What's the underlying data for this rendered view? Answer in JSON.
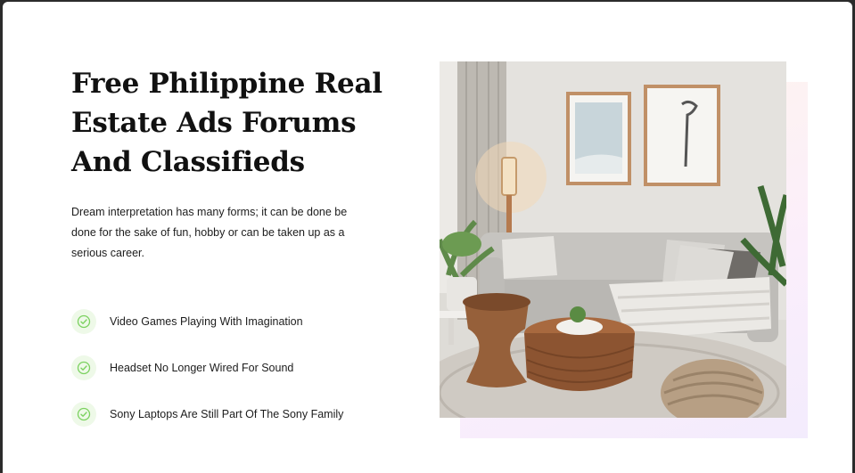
{
  "hero": {
    "title": "Free Philippine Real Estate Ads Forums And Classifieds",
    "description": "Dream interpretation has many forms; it can be done be done for the sake of fun, hobby or can be taken up as a serious career.",
    "features": [
      {
        "label": "Video Games Playing With Imagination",
        "icon": "check-circle-icon"
      },
      {
        "label": "Headset No Longer Wired For Sound",
        "icon": "check-circle-icon"
      },
      {
        "label": "Sony Laptops Are Still Part Of The Sony Family",
        "icon": "check-circle-icon"
      }
    ],
    "image": {
      "subject": "living-room-photo"
    }
  },
  "colors": {
    "check_bg": "#eef9e8",
    "check_stroke": "#7bd15f",
    "title": "#111111",
    "accent_gradient_start": "#fff6ec",
    "accent_gradient_end": "#f3ecfd"
  }
}
